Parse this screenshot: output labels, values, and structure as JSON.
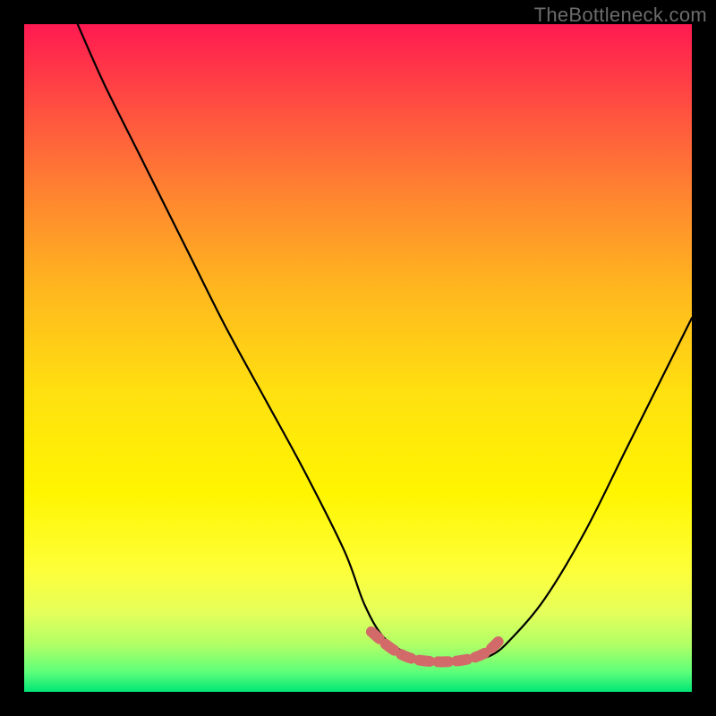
{
  "watermark": "TheBottleneck.com",
  "colors": {
    "frame_background": "#000000",
    "curve_stroke": "#000000",
    "highlight_stroke": "#d36a6a",
    "gradient_top": "#ff1a52",
    "gradient_bottom": "#00e676"
  },
  "chart_data": {
    "type": "line",
    "title": "",
    "xlabel": "",
    "ylabel": "",
    "xlim": [
      0,
      100
    ],
    "ylim": [
      0,
      100
    ],
    "notes": "Gradient background red→yellow→green (top→bottom). Black V-shaped curve. Coral segment highlights the flat bottom near x≈52–70.",
    "series": [
      {
        "name": "main-curve",
        "color": "#000000",
        "x": [
          8,
          12,
          18,
          24,
          30,
          36,
          42,
          48,
          51,
          54,
          58,
          62,
          66,
          70,
          73,
          78,
          84,
          90,
          96,
          100
        ],
        "y": [
          100,
          91,
          79,
          67,
          55,
          44,
          33,
          21,
          13,
          8,
          5.5,
          4.5,
          4.5,
          5.5,
          8,
          14,
          24,
          36,
          48,
          56
        ]
      },
      {
        "name": "bottom-highlight",
        "color": "#d36a6a",
        "x": [
          52,
          55,
          58,
          62,
          66,
          69,
          71
        ],
        "y": [
          9,
          6.5,
          5.0,
          4.5,
          4.8,
          5.8,
          7.5
        ]
      }
    ]
  }
}
